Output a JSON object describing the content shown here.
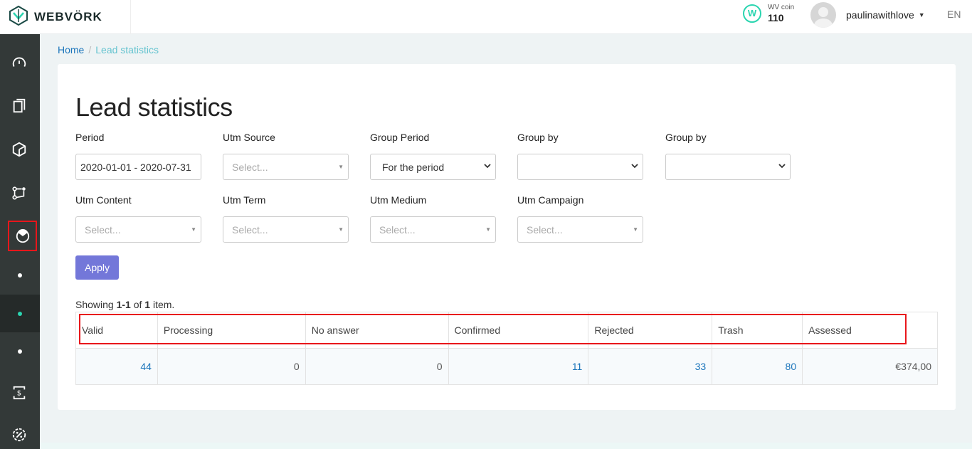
{
  "header": {
    "brand": "WEBVÖRK",
    "coin_label": "WV coin",
    "coin_value": "110",
    "coin_glyph": "W",
    "username": "paulinawithlove",
    "language": "EN"
  },
  "sidebar": {
    "icons": [
      "dashboard-icon",
      "documents-icon",
      "offers-icon",
      "flows-icon",
      "statistics-icon",
      "finance-icon",
      "percent-icon"
    ]
  },
  "breadcrumb": {
    "home": "Home",
    "separator": "/",
    "current": "Lead statistics"
  },
  "page": {
    "title": "Lead statistics"
  },
  "filters": {
    "period": {
      "label": "Period",
      "value": "2020-01-01 - 2020-07-31"
    },
    "utm_source": {
      "label": "Utm Source",
      "placeholder": "Select..."
    },
    "group_period": {
      "label": "Group Period",
      "value": "For the period"
    },
    "group_by_1": {
      "label": "Group by",
      "value": ""
    },
    "group_by_2": {
      "label": "Group by",
      "value": ""
    },
    "utm_content": {
      "label": "Utm Content",
      "placeholder": "Select..."
    },
    "utm_term": {
      "label": "Utm Term",
      "placeholder": "Select..."
    },
    "utm_medium": {
      "label": "Utm Medium",
      "placeholder": "Select..."
    },
    "utm_campaign": {
      "label": "Utm Campaign",
      "placeholder": "Select..."
    },
    "apply_label": "Apply"
  },
  "summary": {
    "prefix": "Showing ",
    "range": "1-1",
    "middle": " of ",
    "total": "1",
    "suffix": " item."
  },
  "table": {
    "headers": [
      "Valid",
      "Processing",
      "No answer",
      "Confirmed",
      "Rejected",
      "Trash",
      "Assessed"
    ],
    "rows": [
      [
        "44",
        "0",
        "0",
        "11",
        "33",
        "80",
        "€374,00"
      ]
    ]
  },
  "colors": {
    "accent": "#7377d9",
    "link": "#1b75bb",
    "sidebar": "#333938",
    "brand_teal": "#2bd5b0",
    "highlight": "#e8161b"
  }
}
